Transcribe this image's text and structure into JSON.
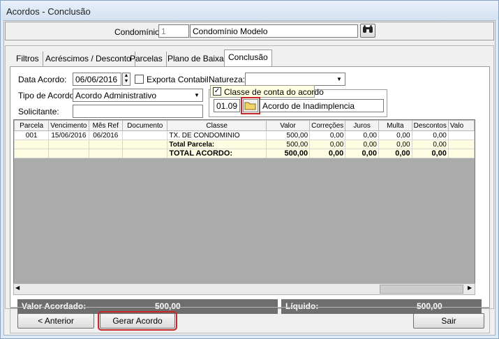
{
  "window": {
    "title": "Acordos - Conclusão"
  },
  "header": {
    "condominio_label": "Condomínio:",
    "condominio_code": "1",
    "condominio_name": "Condomínio Modelo",
    "search_icon": "binoculars-icon"
  },
  "tabs": [
    {
      "label": "Filtros",
      "active": false
    },
    {
      "label": "Acréscimos / Desconto",
      "active": false
    },
    {
      "label": "Parcelas",
      "active": false
    },
    {
      "label": "Plano de Baixa",
      "active": false
    },
    {
      "label": "Conclusão",
      "active": true
    }
  ],
  "form": {
    "data_acordo_label": "Data Acordo:",
    "data_acordo_value": "06/06/2016",
    "exporta_label": "Exporta Contabil",
    "exporta_checked": false,
    "natureza_label": "Natureza:",
    "natureza_value": "",
    "tipo_label": "Tipo de Acordo:",
    "tipo_value": "Acordo Administrativo",
    "solicitante_label": "Solicitante:",
    "solicitante_value": "",
    "classe_group_label": "Classe de conta do acordo",
    "classe_checked": true,
    "classe_code": "01.09",
    "classe_name": "Acordo de Inadimplencia",
    "folder_icon": "folder-icon"
  },
  "grid": {
    "columns": [
      "Parcela",
      "Vencimento",
      "Mês Ref",
      "Documento",
      "Classe",
      "Valor",
      "Correções",
      "Juros",
      "Multa",
      "Descontos",
      "Valo"
    ],
    "rows": [
      [
        "001",
        "15/06/2016",
        "06/2016",
        "",
        "TX. DE CONDOMINIO",
        "500,00",
        "0,00",
        "0,00",
        "0,00",
        "0,00",
        ""
      ],
      [
        "",
        "",
        "",
        "",
        "Total Parcela:",
        "500,00",
        "0,00",
        "0,00",
        "0,00",
        "0,00",
        ""
      ],
      [
        "",
        "",
        "",
        "",
        "TOTAL ACORDO:",
        "500,00",
        "0,00",
        "0,00",
        "0,00",
        "0,00",
        ""
      ]
    ]
  },
  "summary": {
    "valor_acordado_label": "Valor Acordado:",
    "valor_acordado_value": "500,00",
    "liquido_label": "Líquido:",
    "liquido_value": "500,00"
  },
  "footer": {
    "anterior_label": "< Anterior",
    "gerar_label": "Gerar Acordo",
    "sair_label": "Sair"
  }
}
